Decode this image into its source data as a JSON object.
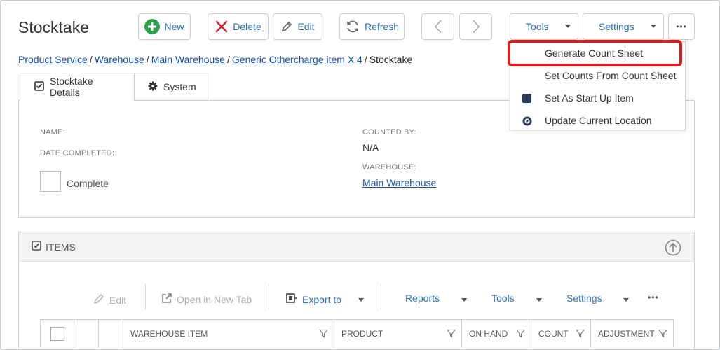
{
  "page": {
    "title": "Stocktake"
  },
  "toolbar": {
    "new_label": "New",
    "delete_label": "Delete",
    "edit_label": "Edit",
    "refresh_label": "Refresh",
    "tools_label": "Tools",
    "settings_label": "Settings",
    "more_label": "•••"
  },
  "breadcrumb": [
    {
      "label": "Product Service",
      "link": true
    },
    {
      "label": "Warehouse",
      "link": true
    },
    {
      "label": "Main Warehouse",
      "link": true
    },
    {
      "label": "Generic Othercharge item X 4",
      "link": true
    },
    {
      "label": "Stocktake",
      "link": false
    }
  ],
  "breadcrumb_separator": "/",
  "tabs": [
    {
      "label": "Stocktake Details",
      "icon": "checkbox-checked-icon",
      "active": true
    },
    {
      "label": "System",
      "icon": "gear-icon",
      "active": false
    }
  ],
  "details": {
    "name_label": "NAME:",
    "date_completed_label": "DATE COMPLETED:",
    "complete_label": "Complete",
    "counted_by_label": "COUNTED BY:",
    "counted_by_value": "N/A",
    "warehouse_label": "WAREHOUSE:",
    "warehouse_value": "Main Warehouse"
  },
  "items": {
    "title": "ITEMS",
    "toolbar": {
      "edit_label": "Edit",
      "open_new_tab_label": "Open in New Tab",
      "export_label": "Export to",
      "reports_label": "Reports",
      "tools_label": "Tools",
      "settings_label": "Settings",
      "more_label": "•••"
    },
    "columns": [
      "WAREHOUSE ITEM",
      "PRODUCT",
      "ON HAND",
      "COUNT",
      "ADJUSTMENT"
    ]
  },
  "tools_menu": {
    "items": [
      {
        "label": "Generate Count Sheet",
        "icon": ""
      },
      {
        "label": "Set Counts From Count Sheet",
        "icon": ""
      },
      {
        "label": "Set As Start Up Item",
        "icon": "square-icon"
      },
      {
        "label": "Update Current Location",
        "icon": "compass-icon"
      }
    ]
  },
  "colors": {
    "link": "#1a4fa0",
    "accent": "#2e6fb7",
    "new_icon": "#2e9e4f",
    "delete_icon": "#d0282e",
    "highlight": "#e01b1b",
    "start_up_icon": "#2c3a5c"
  }
}
